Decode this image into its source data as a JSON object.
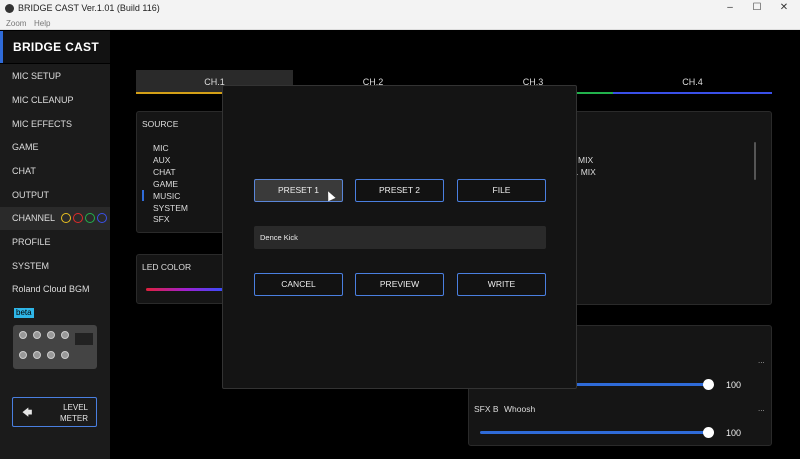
{
  "window": {
    "title": "BRIDGE CAST Ver.1.01 (Build 116)",
    "controls": {
      "minimize": "–",
      "maximize": "☐",
      "close": "✕"
    }
  },
  "menu": {
    "zoom": "Zoom",
    "help": "Help"
  },
  "brand": "BRIDGE CAST",
  "sidebar": {
    "items": [
      {
        "label": "MIC SETUP"
      },
      {
        "label": "MIC CLEANUP"
      },
      {
        "label": "MIC EFFECTS"
      },
      {
        "label": "GAME"
      },
      {
        "label": "CHAT"
      },
      {
        "label": "OUTPUT"
      },
      {
        "label": "CHANNEL"
      },
      {
        "label": "PROFILE"
      },
      {
        "label": "SYSTEM"
      },
      {
        "label": "Roland Cloud BGM"
      }
    ],
    "beta": "beta",
    "channel_colors": [
      "#e8c020",
      "#e02a2a",
      "#22b14c",
      "#3a50e8"
    ],
    "level_meter": {
      "line1": "LEVEL",
      "line2": "METER"
    }
  },
  "tabs": [
    {
      "label": "CH.1",
      "color": "#d4a017"
    },
    {
      "label": "CH.2",
      "color": "#000000"
    },
    {
      "label": "CH.3",
      "color": "#22b14c"
    },
    {
      "label": "CH.4",
      "color": "#3a50e8"
    }
  ],
  "source": {
    "title": "SOURCE",
    "items": [
      "MIC",
      "AUX",
      "CHAT",
      "GAME",
      "MUSIC",
      "SYSTEM",
      "SFX"
    ],
    "selected": "MUSIC"
  },
  "led": {
    "title": "LED COLOR"
  },
  "mix_partial": [
    "MIX",
    ". MIX"
  ],
  "sfx": [
    {
      "label": "",
      "name": "",
      "value": "100",
      "level": 1.0,
      "menu": "..."
    },
    {
      "label": "SFX B",
      "name": "Whoosh",
      "value": "100",
      "level": 1.0,
      "menu": "..."
    }
  ],
  "modal": {
    "preset1": "PRESET 1",
    "preset2": "PRESET 2",
    "file": "FILE",
    "name_value": "Dence Kick",
    "cancel": "CANCEL",
    "preview": "PREVIEW",
    "write": "WRITE"
  }
}
